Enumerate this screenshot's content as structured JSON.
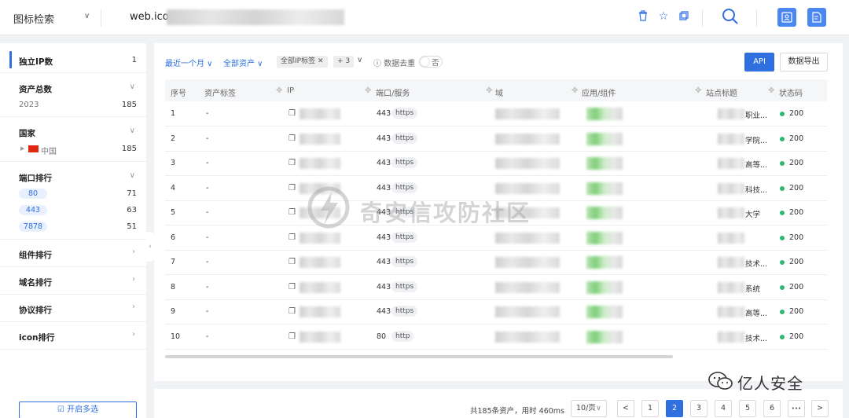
{
  "topbar": {
    "search_type": "图标检索",
    "query": "web.icon"
  },
  "sidebar": {
    "unique_ip": {
      "label": "独立IP数",
      "count": "1"
    },
    "asset_total": {
      "label": "资产总数",
      "items": [
        {
          "label": "2023",
          "count": "185"
        }
      ]
    },
    "country": {
      "label": "国家",
      "items": [
        {
          "label": "中国",
          "count": "185"
        }
      ]
    },
    "port_rank": {
      "label": "端口排行",
      "items": [
        {
          "label": "80",
          "count": "71"
        },
        {
          "label": "443",
          "count": "63"
        },
        {
          "label": "7878",
          "count": "51"
        }
      ]
    },
    "component_rank": "组件排行",
    "domain_rank": "域名排行",
    "protocol_rank": "协议排行",
    "icon_rank": "icon排行",
    "multi_select": "开启多选"
  },
  "filters": {
    "time": "最近一个月",
    "assets": "全部资产",
    "ip_tag": "全部IP标签",
    "more_count": "+ 3",
    "dedup_label": "数据去重",
    "dedup_value": "否",
    "api": "API",
    "export": "数据导出"
  },
  "table": {
    "headers": {
      "no": "序号",
      "tag": "资产标签",
      "ip": "IP",
      "port": "端口/服务",
      "domain": "域",
      "app": "应用/组件",
      "title": "站点标题",
      "status": "状态码"
    },
    "rows": [
      {
        "no": "1",
        "tag": "-",
        "port": "443",
        "service": "https",
        "title_suffix": "职业...",
        "status": "200"
      },
      {
        "no": "2",
        "tag": "-",
        "port": "443",
        "service": "https",
        "title_suffix": "学院...",
        "status": "200"
      },
      {
        "no": "3",
        "tag": "-",
        "port": "443",
        "service": "https",
        "title_suffix": "高等...",
        "status": "200"
      },
      {
        "no": "4",
        "tag": "-",
        "port": "443",
        "service": "https",
        "title_suffix": "科技...",
        "status": "200"
      },
      {
        "no": "5",
        "tag": "-",
        "port": "443",
        "service": "https",
        "title_suffix": "大学",
        "status": "200"
      },
      {
        "no": "6",
        "tag": "-",
        "port": "443",
        "service": "https",
        "title_suffix": "",
        "status": "200"
      },
      {
        "no": "7",
        "tag": "-",
        "port": "443",
        "service": "https",
        "title_suffix": "技术...",
        "status": "200"
      },
      {
        "no": "8",
        "tag": "-",
        "port": "443",
        "service": "https",
        "title_suffix": "系统",
        "status": "200"
      },
      {
        "no": "9",
        "tag": "-",
        "port": "443",
        "service": "https",
        "title_suffix": "高等...",
        "status": "200"
      },
      {
        "no": "10",
        "tag": "-",
        "port": "80",
        "service": "http",
        "title_suffix": "技术...",
        "status": "200"
      }
    ]
  },
  "pagination": {
    "info": "共185条资产，用时 460ms",
    "page_size": "10/页",
    "prev": "<",
    "next": ">",
    "ellipsis": "•••",
    "pages": [
      "1",
      "2",
      "3",
      "4",
      "5",
      "6"
    ],
    "current": "2"
  },
  "watermark": "奇安信攻防社区",
  "signature": "亿人安全",
  "colors": {
    "accent": "#2f6fe0",
    "status_ok": "#2eb872"
  }
}
